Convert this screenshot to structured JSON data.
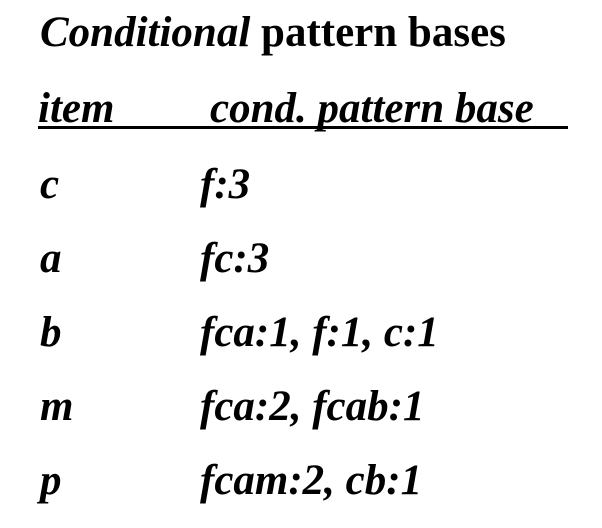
{
  "title": {
    "italic_part": "Conditional",
    "rest": "pattern bases"
  },
  "table": {
    "headers": {
      "item": "item",
      "base": "cond. pattern base"
    },
    "rows": [
      {
        "item": "c",
        "base": "f:3"
      },
      {
        "item": "a",
        "base": "fc:3"
      },
      {
        "item": "b",
        "base": "fca:1, f:1, c:1"
      },
      {
        "item": "m",
        "base": "fca:2, fcab:1"
      },
      {
        "item": "p",
        "base": "fcam:2, cb:1"
      }
    ]
  }
}
